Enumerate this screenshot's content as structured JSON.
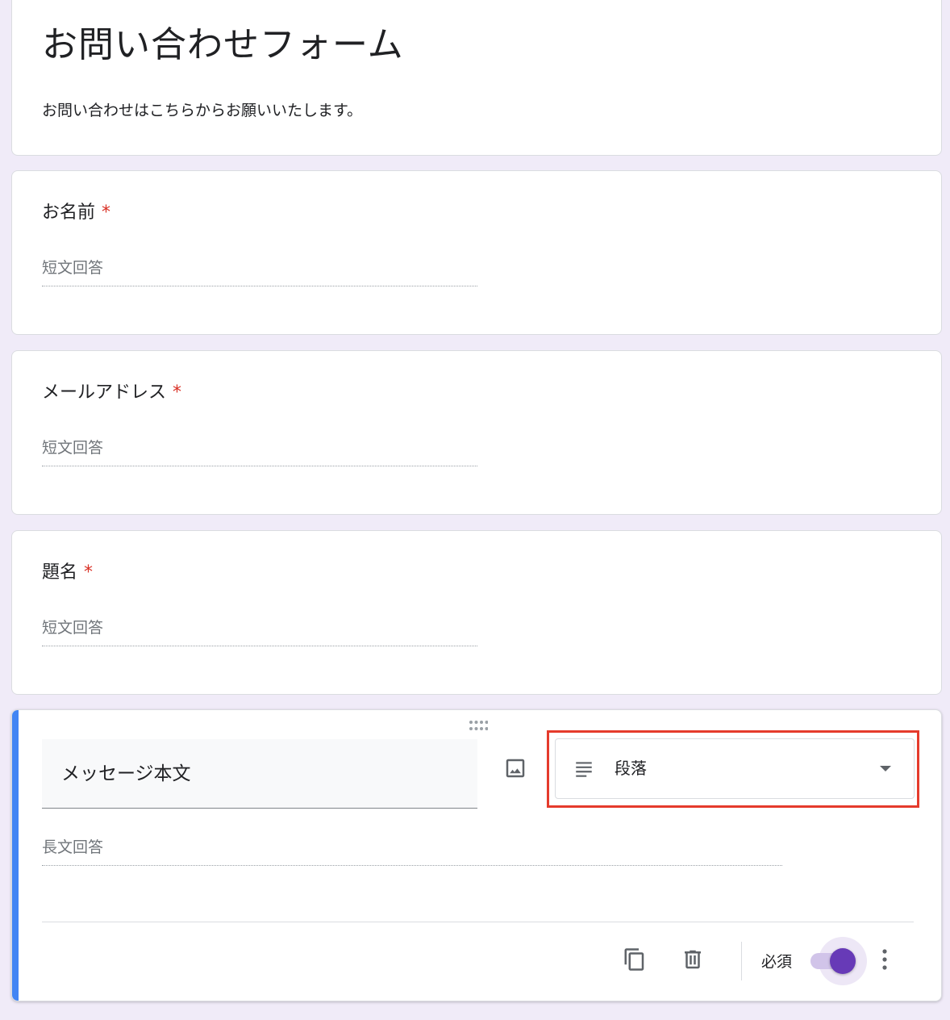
{
  "form": {
    "title": "お問い合わせフォーム",
    "description": "お問い合わせはこちらからお願いいたします。"
  },
  "questions": [
    {
      "title": "お名前",
      "required_mark": "*",
      "answer_placeholder": "短文回答"
    },
    {
      "title": "メールアドレス",
      "required_mark": "*",
      "answer_placeholder": "短文回答"
    },
    {
      "title": "題名",
      "required_mark": "*",
      "answer_placeholder": "短文回答"
    }
  ],
  "active_question": {
    "title": "メッセージ本文",
    "type_label": "段落",
    "type_icon": "subject-lines-icon",
    "answer_placeholder": "長文回答",
    "required_label": "必須",
    "required_on": true
  },
  "colors": {
    "accent": "#673ab7",
    "active_bar": "#4285f4",
    "required_star": "#d93025",
    "highlight_box": "#e53b2c",
    "background": "#f0ebf8"
  }
}
